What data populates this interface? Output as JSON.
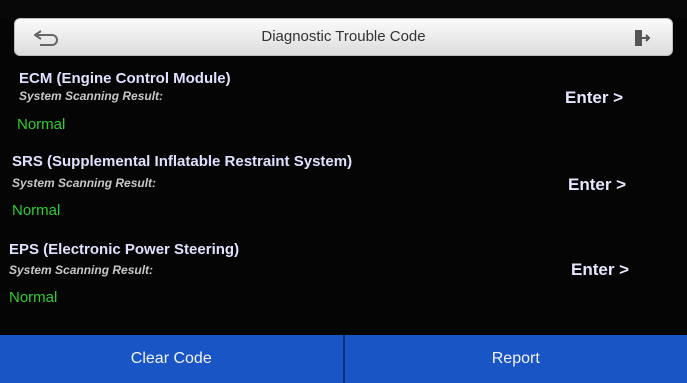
{
  "header": {
    "title": "Diagnostic Trouble Code",
    "back_icon": "back-arrow-icon",
    "exit_icon": "exit-icon"
  },
  "systems": [
    {
      "name": "ECM (Engine Control Module)",
      "scan_label": "System Scanning Result:",
      "result": "Normal",
      "enter_label": "Enter >"
    },
    {
      "name": "SRS (Supplemental Inflatable Restraint System)",
      "scan_label": "System Scanning Result:",
      "result": "Normal",
      "enter_label": "Enter >"
    },
    {
      "name": "EPS (Electronic Power Steering)",
      "scan_label": "System Scanning Result:",
      "result": "Normal",
      "enter_label": "Enter >"
    }
  ],
  "footer": {
    "clear_label": "Clear Code",
    "report_label": "Report"
  },
  "colors": {
    "background": "#050505",
    "normal_status": "#2fcc2f",
    "footer_button": "#1a55c6"
  }
}
